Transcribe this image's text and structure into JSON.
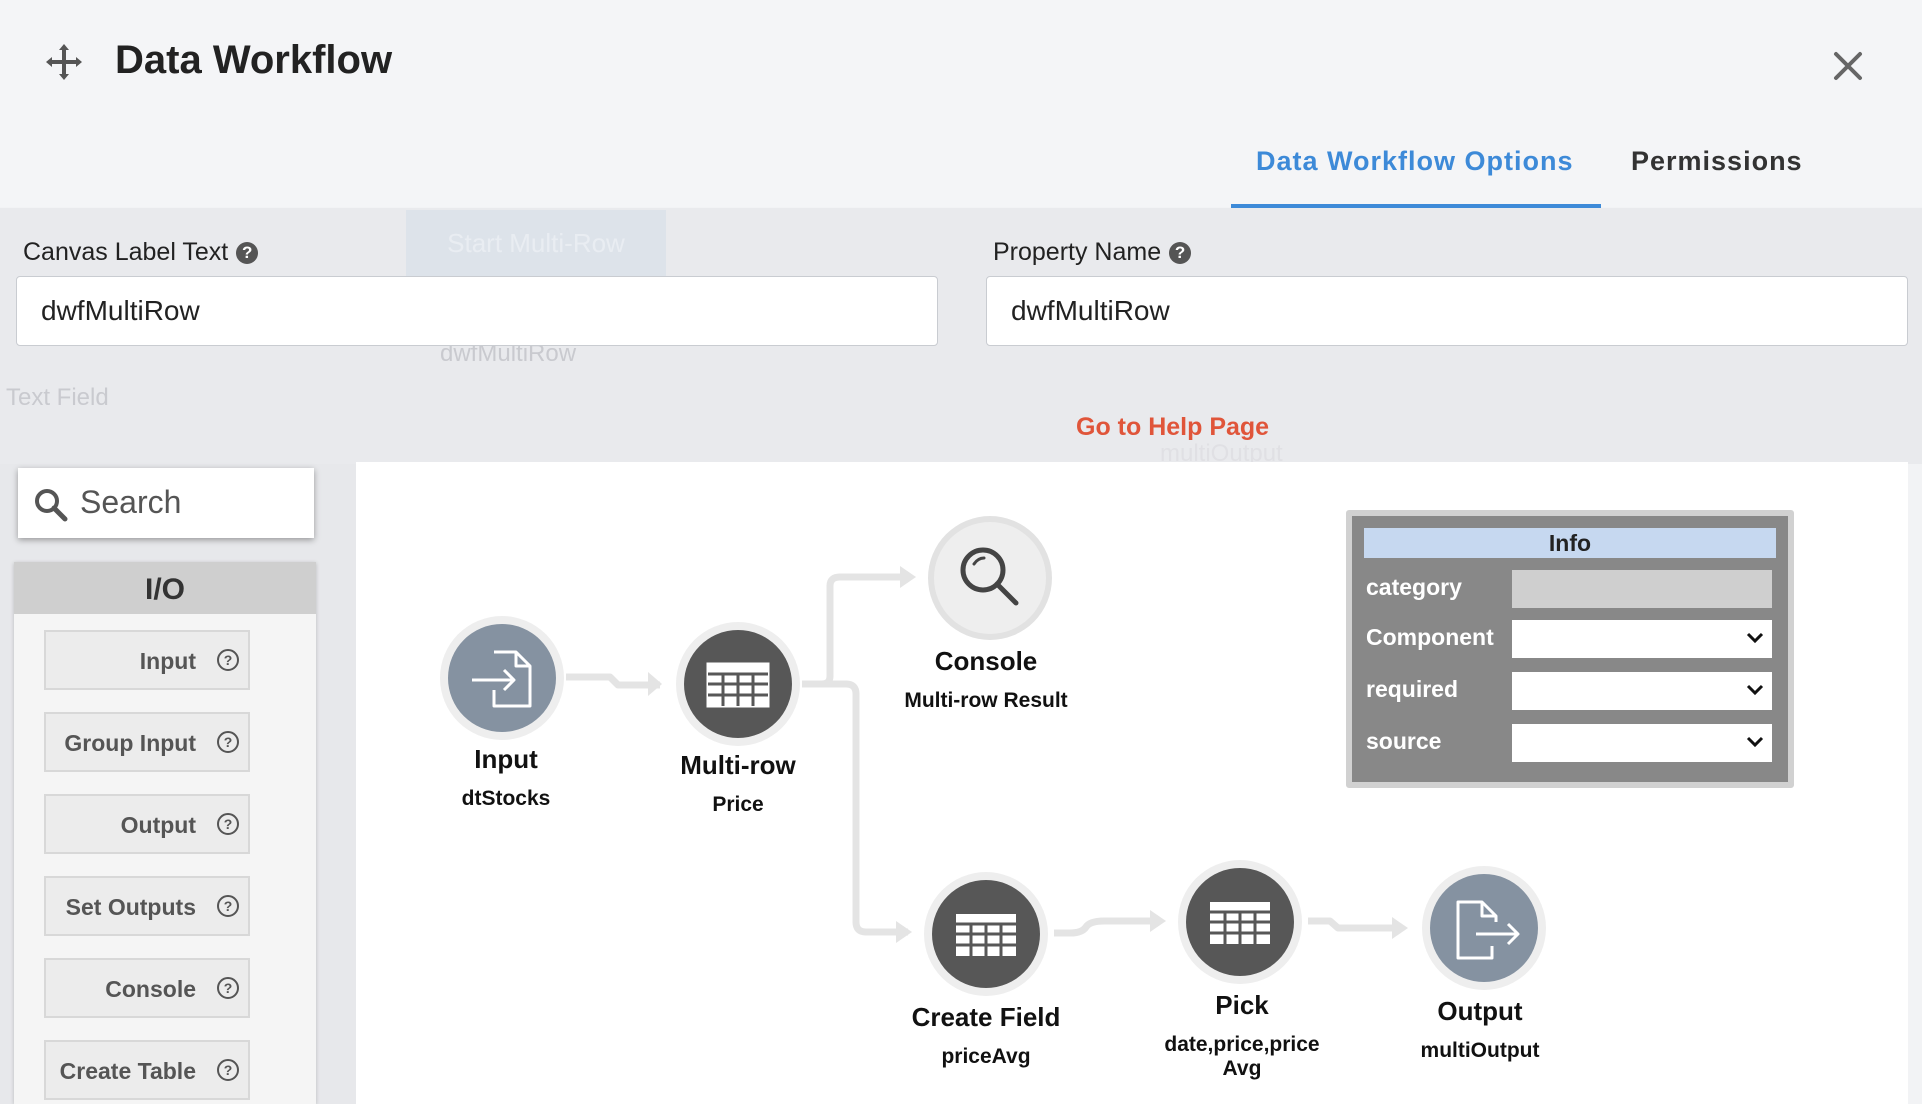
{
  "header": {
    "title": "Data Workflow",
    "tabs": [
      {
        "label": "Data Workflow Options",
        "active": true
      },
      {
        "label": "Permissions",
        "active": false
      }
    ]
  },
  "background_ghost": {
    "button": "Start Multi-Row",
    "node": "dwfMultiRow",
    "sidebar_item": "Text Field",
    "node_output": "multiOutput"
  },
  "form": {
    "canvas_label": {
      "label": "Canvas Label Text",
      "value": "dwfMultiRow"
    },
    "property_name": {
      "label": "Property Name",
      "value": "dwfMultiRow"
    },
    "help_link": "Go to Help Page"
  },
  "palette": {
    "search_placeholder": "Search",
    "section": "I/O",
    "items": [
      "Input",
      "Group Input",
      "Output",
      "Set Outputs",
      "Console",
      "Create Table"
    ]
  },
  "nodes": [
    {
      "title": "Input",
      "sub": "dtStocks",
      "icon": "file-input-icon",
      "color": "#8592a1"
    },
    {
      "title": "Multi-row",
      "sub": "Price",
      "icon": "table-icon",
      "color": "#575757"
    },
    {
      "title": "Console",
      "sub": "Multi-row Result",
      "icon": "magnifier-icon",
      "color": "#ececec"
    },
    {
      "title": "Create Field",
      "sub": "priceAvg",
      "icon": "table-icon",
      "color": "#575757"
    },
    {
      "title": "Pick",
      "sub": "date,price,price Avg",
      "icon": "table-icon",
      "color": "#575757"
    },
    {
      "title": "Output",
      "sub": "multiOutput",
      "icon": "file-output-icon",
      "color": "#8592a1"
    }
  ],
  "info": {
    "title": "Info",
    "rows": [
      "category",
      "Component",
      "required",
      "source"
    ]
  },
  "colors": {
    "accent": "#3d8ad8",
    "help_link": "#e0553a"
  }
}
